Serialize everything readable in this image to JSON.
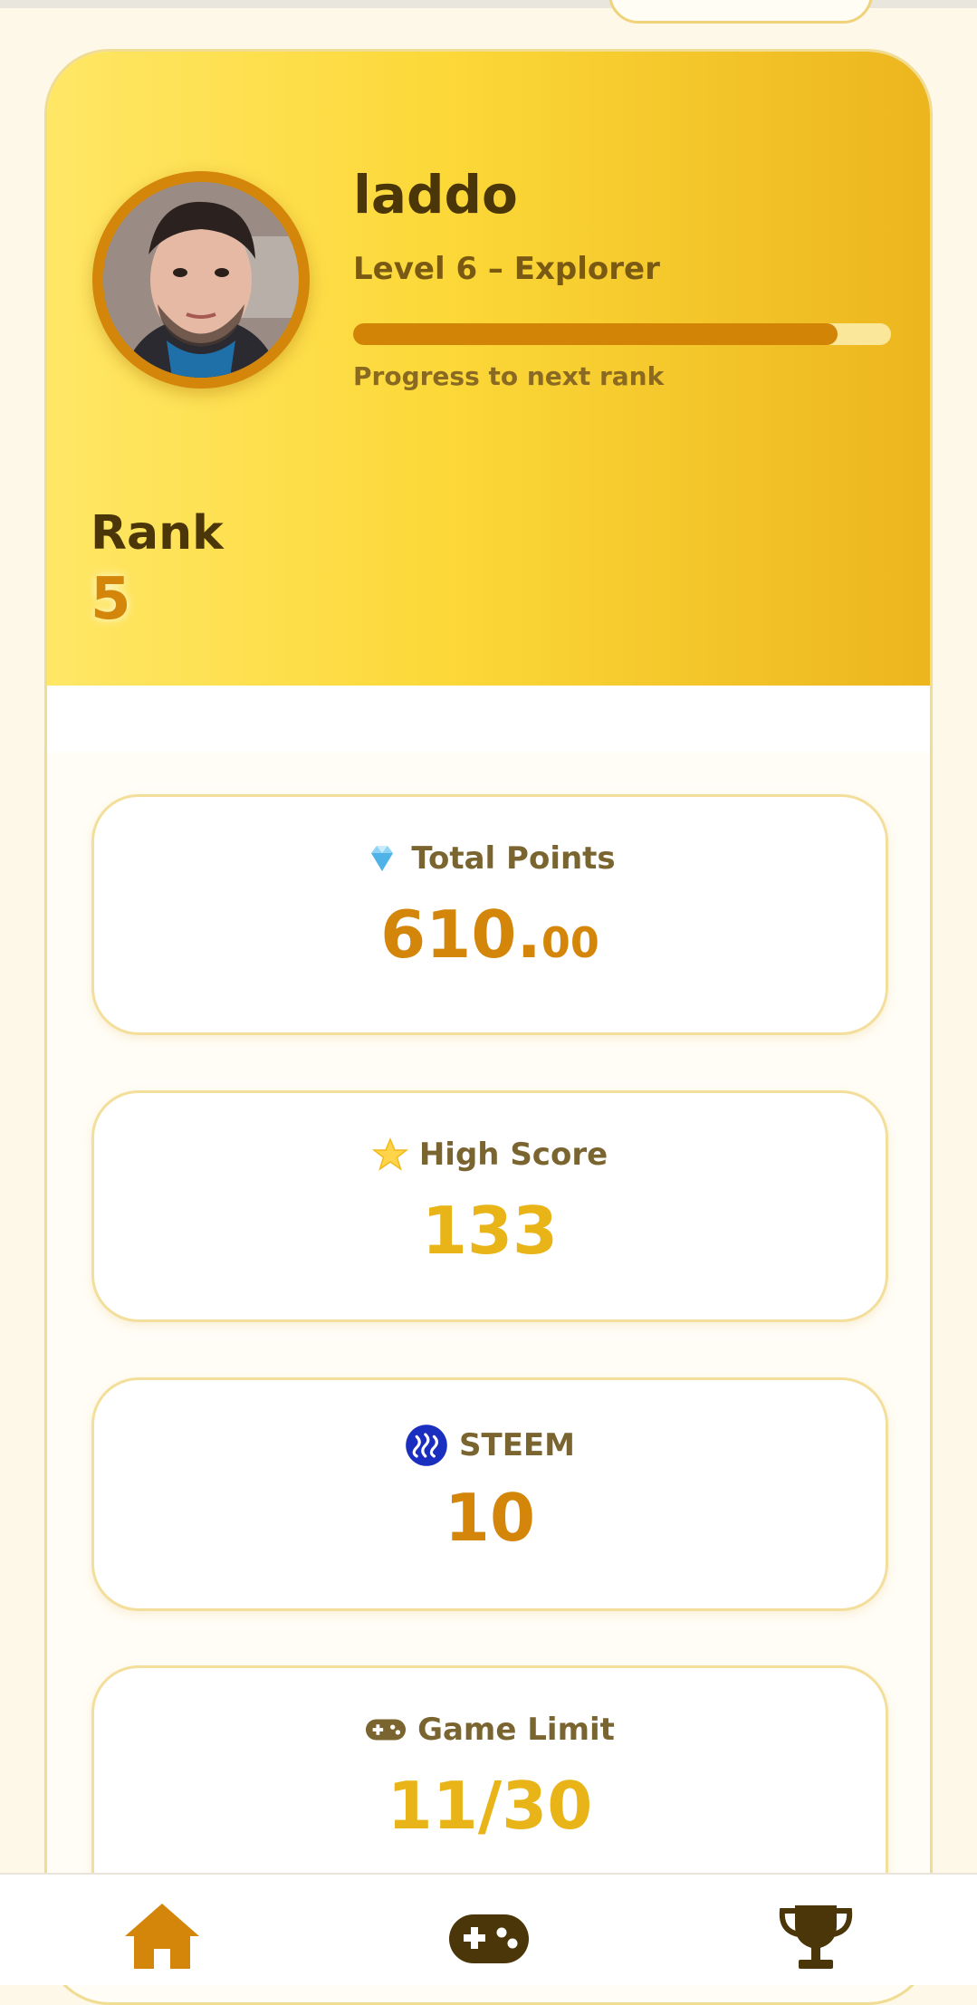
{
  "profile": {
    "username": "laddo",
    "level_text": "Level 6 – Explorer",
    "progress_label": "Progress to next rank",
    "progress_fraction": 0.9,
    "rank_label": "Rank",
    "rank_value": "5"
  },
  "stats": [
    {
      "icon": "gem-icon",
      "title": "Total Points",
      "value_int": "610.",
      "value_dec": "00",
      "color": "#d4860a"
    },
    {
      "icon": "star-icon",
      "title": "High Score",
      "value_int": "133",
      "value_dec": "",
      "color": "#e8b418"
    },
    {
      "icon": "steem-icon",
      "title": "STEEM",
      "value_int": "10",
      "value_dec": "",
      "color": "#d4860a"
    },
    {
      "icon": "gamepad-icon",
      "title": "Game Limit",
      "value_int": "11/30",
      "value_dec": "",
      "color": "#e8b418"
    }
  ],
  "nav": [
    {
      "icon": "home-icon",
      "color": "#d4860a"
    },
    {
      "icon": "gamepad-icon",
      "color": "#4a3608"
    },
    {
      "icon": "trophy-icon",
      "color": "#4a3608"
    }
  ],
  "colors": {
    "accent": "#d4860a",
    "gold": "#e8b418",
    "dark": "#4a3608",
    "background": "#fdf8e8"
  }
}
